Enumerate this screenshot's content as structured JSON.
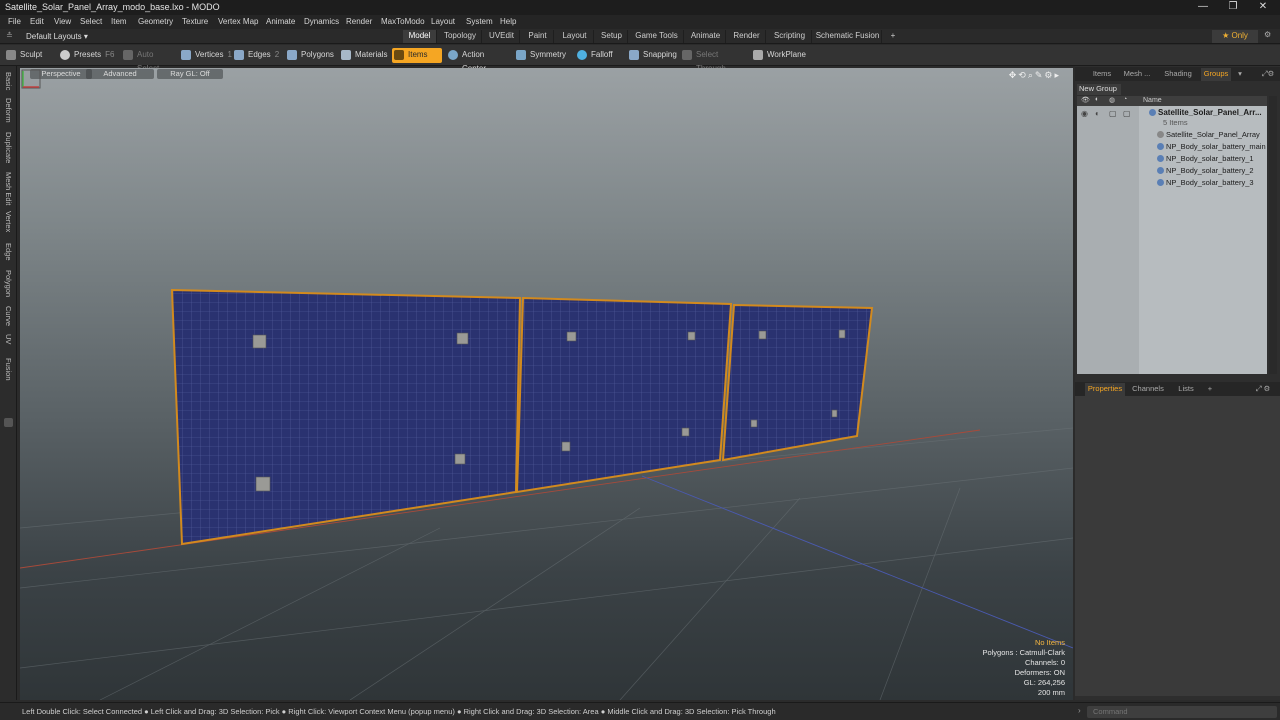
{
  "window": {
    "title": "Satellite_Solar_Panel_Array_modo_base.lxo - MODO",
    "minimize": "—",
    "maximize": "❐",
    "close": "✕"
  },
  "menu": [
    "File",
    "Edit",
    "View",
    "Select",
    "Item",
    "Geometry",
    "Texture",
    "Vertex Map",
    "Animate",
    "Dynamics",
    "Render",
    "MaxToModo",
    "Layout",
    "System",
    "Help"
  ],
  "layouts_label": "Default Layouts ▾",
  "layout_tabs": [
    "Model",
    "Topology",
    "UVEdit",
    "Paint",
    "Layout",
    "Setup",
    "Game Tools",
    "Animate",
    "Render",
    "Scripting",
    "Schematic Fusion"
  ],
  "layout_tab_add": "+",
  "only_label": "★ Only",
  "toolbar": {
    "sculpt": "Sculpt",
    "presets": "Presets",
    "presets_key": "F6",
    "auto_select": "Auto Select",
    "vertices": "Vertices",
    "vertices_key": "1",
    "edges": "Edges",
    "edges_key": "2",
    "polygons": "Polygons",
    "materials": "Materials",
    "items": "Items",
    "action_center": "Action Center",
    "symmetry": "Symmetry",
    "falloff": "Falloff",
    "snapping": "Snapping",
    "select_through": "Select Through",
    "workplane": "WorkPlane"
  },
  "left_tabs": [
    "Basic",
    "Deform",
    "Duplicate",
    "Mesh Edit",
    "Vertex",
    "Edge",
    "Polygon",
    "Curve",
    "UV",
    "Fusion"
  ],
  "viewport": {
    "view_mode": "Perspective",
    "advanced": "Advanced",
    "raygl": "Ray GL: Off",
    "info": {
      "no_items": "No Items",
      "polygons": "Polygons : Catmull-Clark",
      "channels": "Channels: 0",
      "deformers": "Deformers: ON",
      "gl": "GL: 264,256",
      "scale": "200 mm"
    }
  },
  "right_panel": {
    "top_tabs": [
      "Items",
      "Mesh ...",
      "Shading",
      "Groups"
    ],
    "active_top_tab": "Groups",
    "new_group": "New Group",
    "name_header": "Name",
    "group_title": "Satellite_Solar_Panel_Arr...",
    "group_count": "5 Items",
    "items": [
      "Satellite_Solar_Panel_Array",
      "NP_Body_solar_battery_main",
      "NP_Body_solar_battery_1",
      "NP_Body_solar_battery_2",
      "NP_Body_solar_battery_3"
    ],
    "bottom_tabs": [
      "Properties",
      "Channels",
      "Lists"
    ],
    "bottom_add": "+"
  },
  "status_hint": "Left Double Click: Select Connected ● Left Click and Drag: 3D Selection: Pick ● Right Click: Viewport Context Menu (popup menu) ● Right Click and Drag: 3D Selection: Area ● Middle Click and Drag: 3D Selection: Pick Through",
  "command_placeholder": "Command",
  "colors": {
    "accent": "#f5a623",
    "panel_blue": "#27306a",
    "panel_frame": "#d28a1e"
  }
}
